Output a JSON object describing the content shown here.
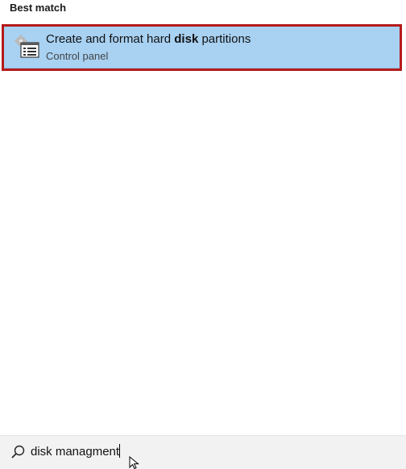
{
  "section": {
    "title": "Best match"
  },
  "best_match": {
    "title_prefix": "Create and format hard ",
    "title_bold": "disk",
    "title_suffix": " partitions",
    "subtitle": "Control panel",
    "icon": "disk-management-icon"
  },
  "search": {
    "icon": "search-icon",
    "query": "disk managment"
  },
  "colors": {
    "selection": "#a8d1f2",
    "highlight_border": "#b51a1a"
  }
}
